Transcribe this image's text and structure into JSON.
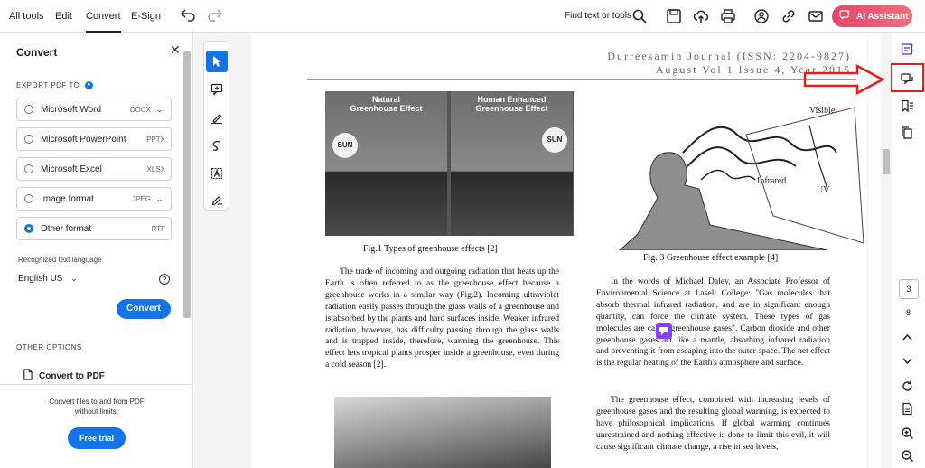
{
  "topbar": {
    "menus": [
      "All tools",
      "Edit",
      "Convert",
      "E-Sign"
    ],
    "find_text": "Find text or tools",
    "ai_label": "AI Assistant"
  },
  "left_panel": {
    "title": "Convert",
    "export_label": "EXPORT PDF TO",
    "formats": [
      {
        "label": "Microsoft Word",
        "ext": "DOCX",
        "selected": false,
        "has_dropdown": true
      },
      {
        "label": "Microsoft PowerPoint",
        "ext": "PPTX",
        "selected": false,
        "has_dropdown": false
      },
      {
        "label": "Microsoft Excel",
        "ext": "XLSX",
        "selected": false,
        "has_dropdown": false
      },
      {
        "label": "Image format",
        "ext": "JPEG",
        "selected": false,
        "has_dropdown": true
      },
      {
        "label": "Other format",
        "ext": "RTF",
        "selected": true,
        "has_dropdown": false
      }
    ],
    "language_label": "Recognized text language",
    "language_value": "English US",
    "convert_button": "Convert",
    "other_options_label": "OTHER OPTIONS",
    "convert_to_pdf": "Convert to PDF",
    "promo_line1": "Convert files to and from PDF",
    "promo_line2": "without limits.",
    "free_trial": "Free trial"
  },
  "document": {
    "journal_line1": "Durreesamin Journal (ISSN: 2204-9827)",
    "journal_line2": "August Vol 1 Issue 4, Year 2015",
    "fig1_left_title_1": "Natural",
    "fig1_left_title_2": "Greenhouse Effect",
    "fig1_right_title_1": "Human Enhanced",
    "fig1_right_title_2": "Greenhouse Effect",
    "sun": "SUN",
    "fig1_caption": "Fig.1 Types of greenhouse effects [2]",
    "fig3_caption": "Fig. 3 Greenhouse effect example [4]",
    "fig3_visible": "Visible",
    "fig3_infrared": "Infrared",
    "fig3_uv": "UV",
    "left_paragraph": "The trade of incoming and outgoing radiation that heats up the Earth is often referred to as the greenhouse effect because a greenhouse works in a similar way (Fig.2). Incoming ultraviolet radiation easily passes through the glass walls of a greenhouse and is absorbed by the plants and hard surfaces inside. Weaker infrared radiation, however, has difficulty passing through the glass walls and is trapped inside, therefore, warming the greenhouse. This effect lets tropical plants prosper inside a greenhouse, even during a cold season [2].",
    "right_paragraph_1": "In the words of Michael Daley, an Associate Professor of Environmental Science at Lasell College: \"Gas molecules that absorb thermal infrared radiation, and are in significant enough quantity, can force the climate system. These types of gas molecules are called greenhouse gases\". Carbon dioxide and other greenhouse gases act like a mantle, absorbing infrared radiation and preventing it from escaping into the outer space. The net effect is the regular heating of the Earth's atmosphere and surface.",
    "right_paragraph_2": "The greenhouse effect, combined with increasing levels of greenhouse gases and the resulting global warming, is expected to have philosophical implications. If global warming continues unrestrained and nothing effective is done to limit this evil, it will cause significant climate change, a rise in sea levels,"
  },
  "right_rail": {
    "current_page": "3",
    "total_pages": "8"
  },
  "colors": {
    "accent": "#1473e6",
    "ai_gradient_start": "#e8456b",
    "annotation_red": "#e02020",
    "comment_purple": "#8a3ffc"
  }
}
